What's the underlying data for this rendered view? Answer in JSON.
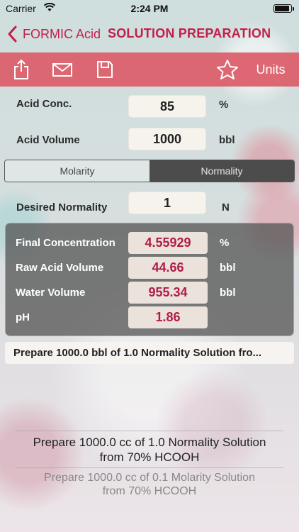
{
  "status_bar": {
    "carrier": "Carrier",
    "time": "2:24 PM",
    "battery_level": 0.9
  },
  "nav": {
    "back_label": "FORMIC Acid",
    "title": "SOLUTION PREPARATION"
  },
  "toolbar": {
    "icons": [
      "share-icon",
      "mail-icon",
      "save-icon",
      "star-icon"
    ],
    "units_label": "Units"
  },
  "inputs": {
    "acid_conc": {
      "label": "Acid Conc.",
      "value": "85",
      "unit": "%"
    },
    "acid_volume": {
      "label": "Acid Volume",
      "value": "1000",
      "unit": "bbl"
    }
  },
  "segmented": {
    "molarity": "Molarity",
    "normality": "Normality",
    "selected": "Normality"
  },
  "desired": {
    "label": "Desired Normality",
    "value": "1",
    "unit": "N"
  },
  "results": [
    {
      "label": "Final Concentration",
      "value": "4.55929",
      "unit": "%"
    },
    {
      "label": "Raw Acid Volume",
      "value": "44.66",
      "unit": "bbl"
    },
    {
      "label": "Water Volume",
      "value": "955.34",
      "unit": "bbl"
    },
    {
      "label": "pH",
      "value": "1.86",
      "unit": ""
    }
  ],
  "recipe_text": "Prepare 1000.0 bbl of 1.0 Normality Solution fro...",
  "picker": {
    "selected_line1": "Prepare 1000.0 cc of 1.0 Normality Solution",
    "selected_line2": "from 70% HCOOH",
    "next_line1": "Prepare 1000.0 cc of 0.1 Molarity Solution",
    "next_line2": "from 70% HCOOH"
  },
  "colors": {
    "accent": "#c2204a",
    "toolbar": "#db5c68",
    "result_value": "#b01c48"
  }
}
